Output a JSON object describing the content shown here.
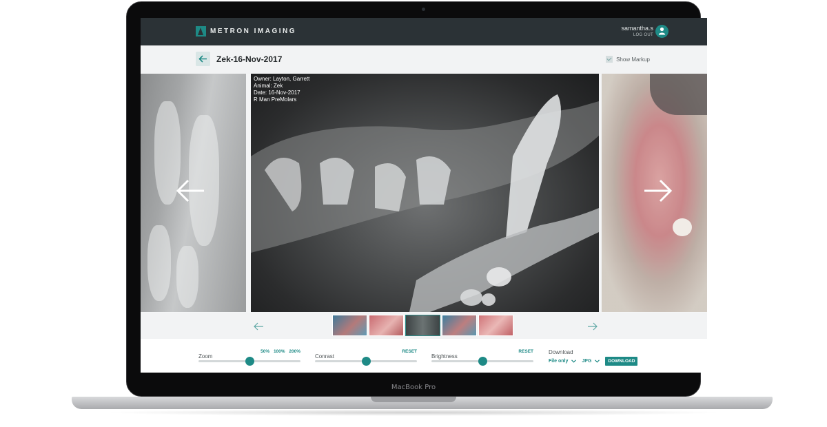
{
  "device": {
    "label": "MacBook Pro"
  },
  "header": {
    "app_name": "METRON  IMAGING",
    "username": "samantha.s",
    "logout_label": "LOG OUT",
    "accent_color": "#1e8a86",
    "bar_color": "#2b3236"
  },
  "page": {
    "title": "Zek-16-Nov-2017",
    "show_markup_label": "Show Markup",
    "show_markup_checked": true
  },
  "image_info": {
    "owner": "Owner: Layton, Garrett",
    "animal": "Animal: Zek",
    "date": "Date: 16-Nov-2017",
    "region": "R Man PreMolars"
  },
  "thumbnails": {
    "count": 5,
    "active_index": 2
  },
  "controls": {
    "zoom": {
      "label": "Zoom",
      "options": [
        "50%",
        "100%",
        "200%"
      ],
      "level": 0.5
    },
    "contrast": {
      "label": "Conrast",
      "reset_label": "RESET",
      "level": 0.5
    },
    "brightness": {
      "label": "Brightness",
      "reset_label": "RESET",
      "level": 0.5
    },
    "download": {
      "label": "Download",
      "scope_value": "File only",
      "format_value": "JPG",
      "button_label": "DOWNLOAD"
    }
  }
}
